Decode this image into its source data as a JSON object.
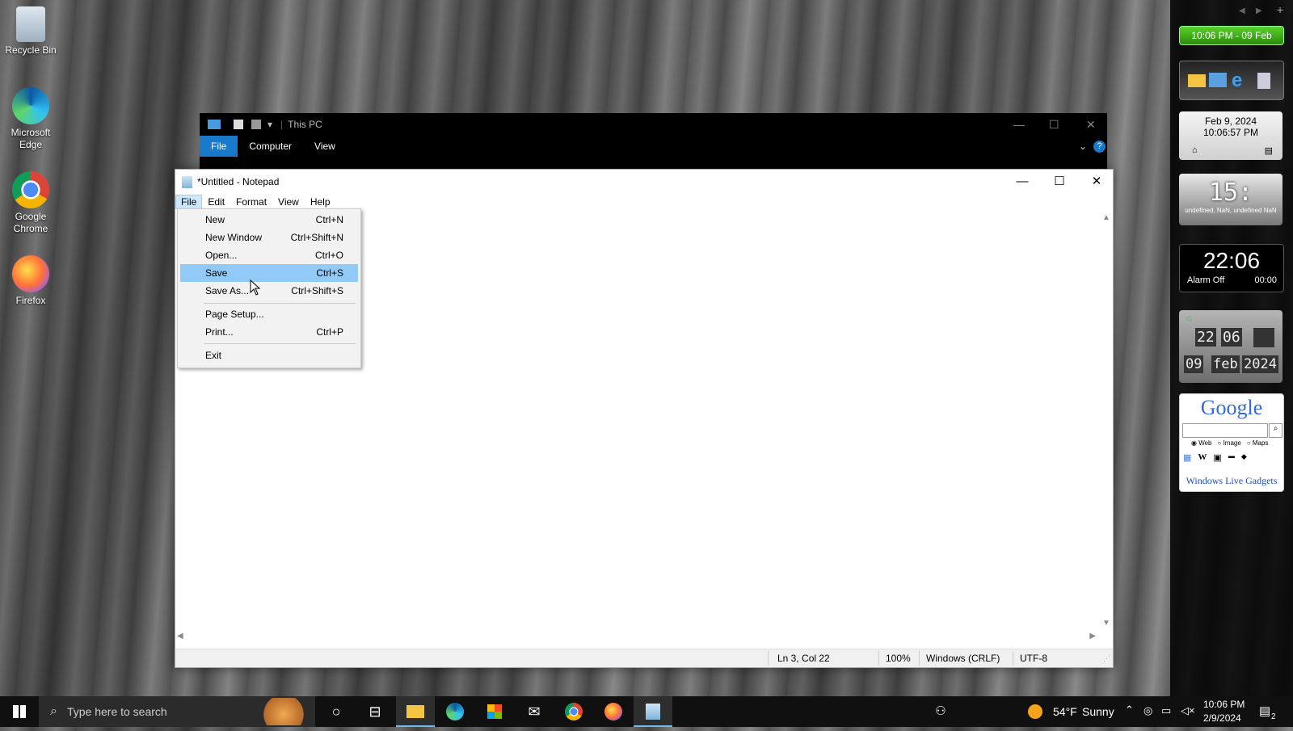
{
  "desktop": {
    "icons": [
      {
        "label": "Recycle Bin"
      },
      {
        "label": "Microsoft Edge"
      },
      {
        "label": "Google Chrome"
      },
      {
        "label": "Firefox"
      }
    ]
  },
  "explorer": {
    "title": "This PC",
    "tabs": [
      "File",
      "Computer",
      "View"
    ],
    "active_tab": "File"
  },
  "notepad": {
    "title": "*Untitled - Notepad",
    "menu": [
      "File",
      "Edit",
      "Format",
      "View",
      "Help"
    ],
    "active_menu": "File",
    "status": {
      "position": "Ln 3, Col 22",
      "zoom": "100%",
      "line_ending": "Windows (CRLF)",
      "encoding": "UTF-8"
    }
  },
  "file_menu": {
    "items": [
      {
        "label": "New",
        "shortcut": "Ctrl+N"
      },
      {
        "label": "New Window",
        "shortcut": "Ctrl+Shift+N"
      },
      {
        "label": "Open...",
        "shortcut": "Ctrl+O"
      },
      {
        "label": "Save",
        "shortcut": "Ctrl+S"
      },
      {
        "label": "Save As...",
        "shortcut": "Ctrl+Shift+S"
      },
      {
        "label": "Page Setup...",
        "shortcut": ""
      },
      {
        "label": "Print...",
        "shortcut": "Ctrl+P"
      },
      {
        "label": "Exit",
        "shortcut": ""
      }
    ],
    "highlighted": "Save"
  },
  "gadgets": {
    "clock_bar": "10:06 PM - 09 Feb",
    "calendar": {
      "date": "Feb 9, 2024",
      "time": "10:06:57 PM"
    },
    "digital_clock": {
      "time": "15:",
      "caption": "undefined, NaN, undefined NaN"
    },
    "alarm_clock": {
      "time": "22:06",
      "alarm": "Alarm Off",
      "timer": "00:00"
    },
    "flip_clock": {
      "hours": "22",
      "minutes": "06",
      "day": "09",
      "month": "feb",
      "year": "2024"
    },
    "google": {
      "logo": "Google",
      "options": [
        "Web",
        "Image",
        "Maps"
      ],
      "footer": "Windows Live Gadgets"
    }
  },
  "taskbar": {
    "search_placeholder": "Type here to search",
    "weather": {
      "temp": "54°F",
      "condition": "Sunny"
    },
    "time": "10:06 PM",
    "date": "2/9/2024",
    "notifications": "2"
  },
  "colors": {
    "accent": "#1979ca",
    "menu_highlight": "#91c9f7",
    "gadget_green": "#3a9a16"
  }
}
